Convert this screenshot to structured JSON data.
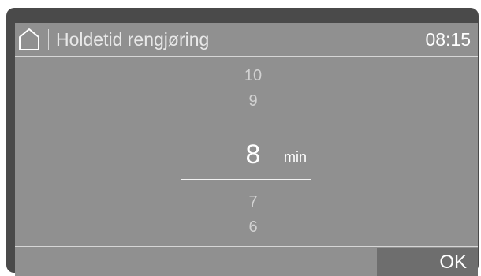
{
  "header": {
    "home_icon": "home-icon",
    "title": "Holdetid rengjøring",
    "time": "08:15"
  },
  "picker": {
    "above": [
      "10",
      "9"
    ],
    "selected": "8",
    "unit": "min",
    "below": [
      "7",
      "6"
    ]
  },
  "footer": {
    "ok_label": "OK"
  },
  "colors": {
    "screen_bg": "#909090",
    "bezel": "#4a4a4a",
    "ok_button_bg": "#6e6e6e",
    "text_primary": "#ffffff",
    "text_secondary": "#d2d2d2"
  }
}
